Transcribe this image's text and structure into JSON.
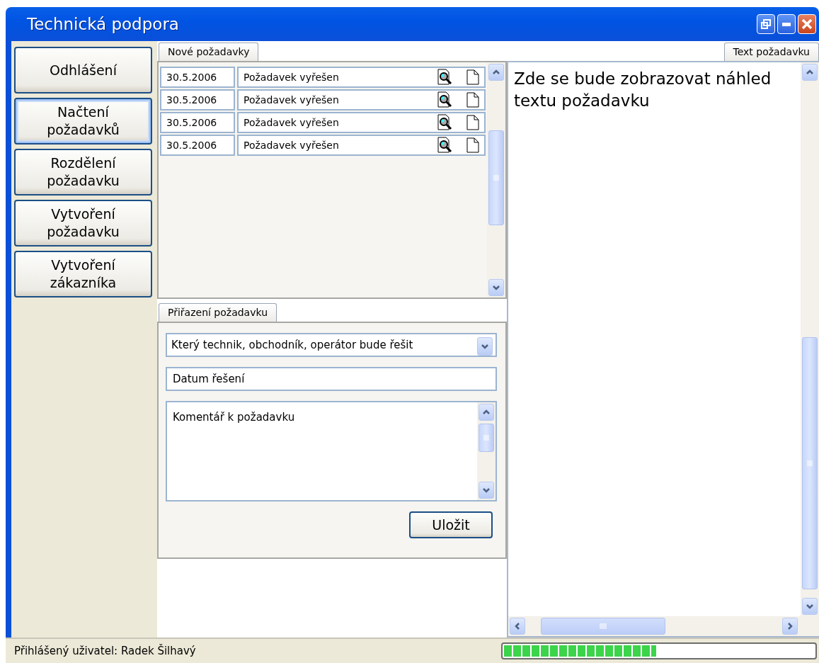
{
  "window": {
    "title": "Technická podpora"
  },
  "sidebar": {
    "items": [
      {
        "label": "Odhlášení",
        "selected": false
      },
      {
        "label": "Načtení požadavků",
        "selected": true
      },
      {
        "label": "Rozdělení požadavku",
        "selected": false
      },
      {
        "label": "Vytvoření požadavku",
        "selected": false
      },
      {
        "label": "Vytvoření zákazníka",
        "selected": false
      }
    ]
  },
  "requests": {
    "tab": "Nové požadavky",
    "rows": [
      {
        "date": "30.5.2006",
        "status": "Požadavek vyřešen"
      },
      {
        "date": "30.5.2006",
        "status": "Požadavek vyřešen"
      },
      {
        "date": "30.5.2006",
        "status": "Požadavek vyřešen"
      },
      {
        "date": "30.5.2006",
        "status": "Požadavek vyřešen"
      }
    ]
  },
  "assignment": {
    "tab": "Přiřazení požadavku",
    "assignee": {
      "placeholder": "Který technik, obchodník, operátor bude řešit"
    },
    "date": {
      "placeholder": "Datum řešení"
    },
    "comment": {
      "placeholder": "Komentář k požadavku"
    },
    "save_button": "Uložit"
  },
  "preview": {
    "tab": "Text požadavku",
    "text": "Zde se bude zobrazovat náhled textu požadavku"
  },
  "status_bar": {
    "user": "Přihlášený uživatel: Radek Šilhavý",
    "progress": {
      "level": 0.49
    }
  }
}
